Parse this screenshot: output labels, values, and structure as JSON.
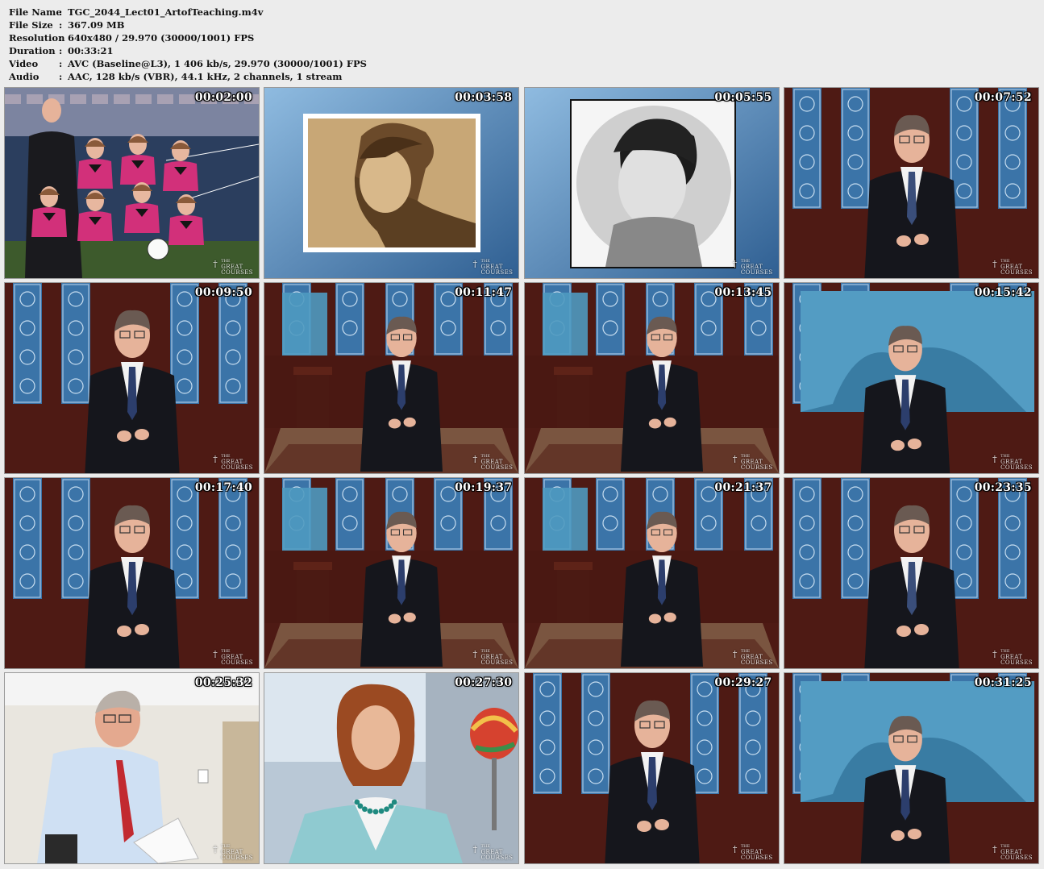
{
  "file_info": {
    "rows": [
      {
        "label": "File Name",
        "value": "TGC_2044_Lect01_ArtofTeaching.m4v"
      },
      {
        "label": "File Size",
        "value": "367.09 MB"
      },
      {
        "label": "Resolution",
        "value": "640x480 / 29.970 (30000/1001) FPS"
      },
      {
        "label": "Duration",
        "value": "00:33:21"
      },
      {
        "label": "Video",
        "value": "AVC (Baseline@L3), 1 406 kb/s, 29.970 (30000/1001) FPS"
      },
      {
        "label": "Audio",
        "value": "AAC, 128 kb/s (VBR), 44.1 kHz, 2 channels, 1 stream"
      }
    ]
  },
  "logo": {
    "line1": "THE",
    "line2": "GREAT",
    "line3": "COURSES"
  },
  "thumbnails": [
    {
      "timestamp": "00:02:00",
      "scene": "team"
    },
    {
      "timestamp": "00:03:58",
      "scene": "sepia"
    },
    {
      "timestamp": "00:05:55",
      "scene": "bw"
    },
    {
      "timestamp": "00:07:52",
      "scene": "speaker-close"
    },
    {
      "timestamp": "00:09:50",
      "scene": "speaker-close"
    },
    {
      "timestamp": "00:11:47",
      "scene": "speaker-wide"
    },
    {
      "timestamp": "00:13:45",
      "scene": "speaker-wide"
    },
    {
      "timestamp": "00:15:42",
      "scene": "speaker-mural"
    },
    {
      "timestamp": "00:17:40",
      "scene": "speaker-close"
    },
    {
      "timestamp": "00:19:37",
      "scene": "speaker-wide"
    },
    {
      "timestamp": "00:21:37",
      "scene": "speaker-wide"
    },
    {
      "timestamp": "00:23:35",
      "scene": "speaker-close"
    },
    {
      "timestamp": "00:25:32",
      "scene": "classroom"
    },
    {
      "timestamp": "00:27:30",
      "scene": "interview"
    },
    {
      "timestamp": "00:29:27",
      "scene": "speaker-close"
    },
    {
      "timestamp": "00:31:25",
      "scene": "speaker-mural"
    }
  ],
  "colors": {
    "background": "#ececec",
    "panel_blue": "#3b74a8",
    "wood": "#5a1f17",
    "suit": "#15161c"
  }
}
